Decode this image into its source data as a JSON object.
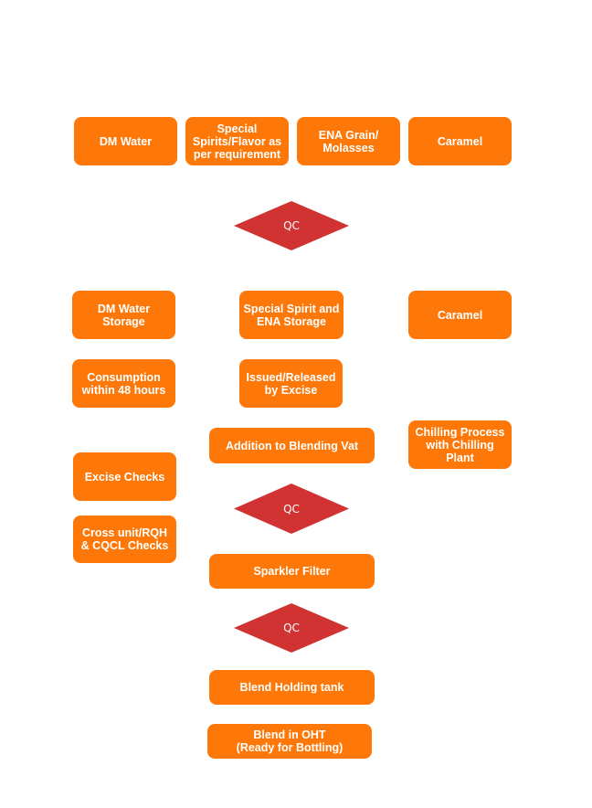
{
  "colors": {
    "box": "#fd7808",
    "qc": "#d13232",
    "text": "#ffffff",
    "background": "#ffffff"
  },
  "row1": [
    {
      "label": "DM Water"
    },
    {
      "label": "Special\nSpirits/Flavor as\nper requirement"
    },
    {
      "label": "ENA Grain/\nMolasses"
    },
    {
      "label": "Caramel"
    }
  ],
  "qc": [
    "QC",
    "QC",
    "QC"
  ],
  "left": [
    {
      "label": "DM Water\nStorage"
    },
    {
      "label": "Consumption\nwithin 48 hours"
    },
    {
      "label": "Excise Checks"
    },
    {
      "label": "Cross unit/RQH\n& CQCL Checks"
    }
  ],
  "center": [
    {
      "label": "Special Spirit and\nENA Storage"
    },
    {
      "label": "Issued/Released\nby Excise"
    },
    {
      "label": "Addition to Blending Vat"
    },
    {
      "label": "Sparkler Filter"
    },
    {
      "label": "Blend Holding tank"
    },
    {
      "label": "Blend in OHT\n(Ready for Bottling)"
    }
  ],
  "right": [
    {
      "label": "Caramel"
    },
    {
      "label": "Chilling Process\nwith Chilling\nPlant"
    }
  ]
}
